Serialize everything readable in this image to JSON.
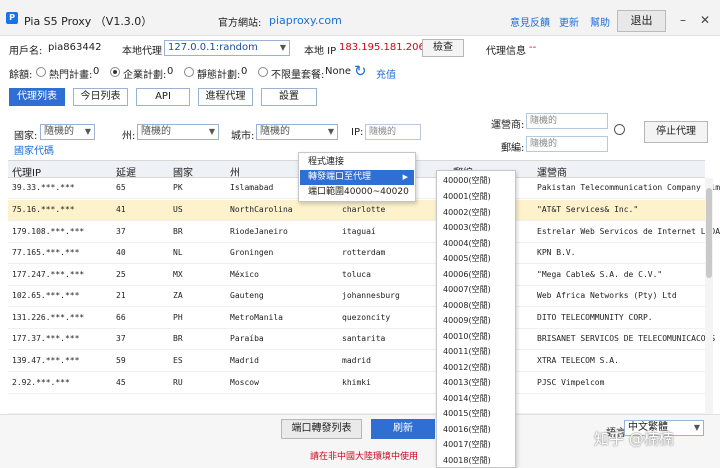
{
  "app": {
    "title": "Pia S5 Proxy （V1.3.0）",
    "site_label": "官方網站:",
    "site": "piaproxy.com",
    "logo_letter": "P"
  },
  "toplinks": {
    "feedback": "意見反饋",
    "update": "更新",
    "help": "幫助",
    "logout": "退出"
  },
  "account": {
    "user_label": "用戶名:",
    "user": "pia863442",
    "local_proxy_label": "本地代理",
    "local_proxy": "127.0.0.1:random",
    "local_ip_label": "本地 IP",
    "local_ip": "183.195.181.206",
    "check_button": "檢查",
    "proxy_info_label": "代理信息",
    "proxy_info": "--"
  },
  "balance": {
    "label": "餘額:",
    "plans": [
      {
        "label": "熱門計畫:",
        "value": "0",
        "selected": false
      },
      {
        "label": "企業計劃:",
        "value": "0",
        "selected": true
      },
      {
        "label": "靜態計劃:",
        "value": "0",
        "selected": false
      },
      {
        "label": "不限量套餐:",
        "value": "None",
        "selected": false
      }
    ],
    "recharge": "充值"
  },
  "tabs": [
    {
      "label": "代理列表",
      "active": true
    },
    {
      "label": "今日列表",
      "active": false
    },
    {
      "label": "API",
      "active": false
    },
    {
      "label": "進程代理",
      "active": false
    },
    {
      "label": "設置",
      "active": false
    }
  ],
  "filters": {
    "country_label": "國家:",
    "country_value": "隨機的",
    "state_label": "州:",
    "state_value": "隨機的",
    "city_label": "城市:",
    "city_value": "隨機的",
    "ip_label": "IP:",
    "ip_placeholder": "隨機的",
    "isp_label": "運營商:",
    "isp_placeholder": "隨機的",
    "zip_label": "郵編:",
    "zip_placeholder": "隨機的",
    "country_code_link": "國家代碼",
    "stop_button": "停止代理"
  },
  "table": {
    "headers": [
      "代理IP",
      "延遲",
      "國家",
      "州",
      "",
      "郵編",
      "運營商"
    ],
    "rows": [
      [
        "39.33.***.***",
        "65",
        "PK",
        "Islamabad",
        "",
        "",
        "Pakistan Telecommunication Company Lim"
      ],
      [
        "75.16.***.***",
        "41",
        "US",
        "NorthCarolina",
        "charlotte",
        "",
        "\"AT&T Services& Inc.\""
      ],
      [
        "179.108.***.***",
        "37",
        "BR",
        "RiodeJaneiro",
        "itaguaí",
        "",
        "Estrelar Web Servicos de Internet LTDA"
      ],
      [
        "77.165.***.***",
        "40",
        "NL",
        "Groningen",
        "rotterdam",
        "",
        "KPN B.V."
      ],
      [
        "177.247.***.***",
        "25",
        "MX",
        "México",
        "toluca",
        "",
        "\"Mega Cable& S.A. de C.V.\""
      ],
      [
        "102.65.***.***",
        "21",
        "ZA",
        "Gauteng",
        "johannesburg",
        "",
        "Web Africa Networks (Pty) Ltd"
      ],
      [
        "131.226.***.***",
        "66",
        "PH",
        "MetroManila",
        "quezoncity",
        "",
        "DITO TELECOMMUNITY CORP."
      ],
      [
        "177.37.***.***",
        "37",
        "BR",
        "Paraíba",
        "santarita",
        "",
        "BRISANET SERVICOS DE TELECOMUNICACOES"
      ],
      [
        "139.47.***.***",
        "59",
        "ES",
        "Madrid",
        "madrid",
        "",
        "XTRA TELECOM S.A."
      ],
      [
        "2.92.***.***",
        "45",
        "RU",
        "Moscow",
        "khimki",
        "",
        "PJSC Vimpelcom"
      ],
      [
        "",
        "",
        "",
        "",
        "",
        "",
        ""
      ]
    ]
  },
  "context_menu": {
    "items": [
      "程式連接",
      "轉發端口至代理",
      "端口範圍40000~40020"
    ],
    "submenu_arrow": "▶"
  },
  "ports": [
    "40000(空閒)",
    "40001(空閒)",
    "40002(空閒)",
    "40003(空閒)",
    "40004(空閒)",
    "40005(空閒)",
    "40006(空閒)",
    "40007(空閒)",
    "40008(空閒)",
    "40009(空閒)",
    "40010(空閒)",
    "40011(空閒)",
    "40012(空閒)",
    "40013(空閒)",
    "40014(空閒)",
    "40015(空閒)",
    "40016(空閒)",
    "40017(空閒)",
    "40018(空閒)"
  ],
  "bottom": {
    "port_forward_button": "端口轉發列表",
    "refresh_button": "刷新",
    "warning": "請在非中國大陸環境中使用",
    "language_label": "語言:",
    "language_value": "中文繁體",
    "watermark": "知乎 @楠楠"
  },
  "colors": {
    "accent": "#2f6fd3",
    "ip_red": "#d0021b",
    "link": "#1a6fd6",
    "selected_row": "#fdf2cc"
  }
}
